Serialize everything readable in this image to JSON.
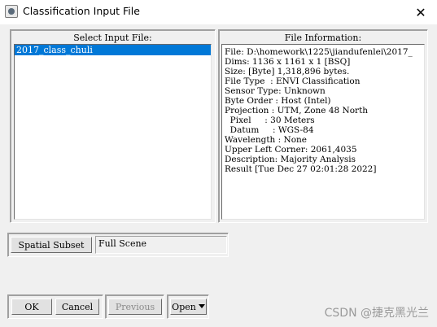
{
  "window": {
    "title": "Classification Input File",
    "close_glyph": "✕"
  },
  "select_panel": {
    "header": "Select Input File:",
    "files": [
      "2017_class_chuli"
    ]
  },
  "info_panel": {
    "header": "File Information:",
    "lines": [
      "File: D:\\homework\\1225\\jiandufenlei\\2017_",
      "Dims: 1136 x 1161 x 1 [BSQ]",
      "Size: [Byte] 1,318,896 bytes.",
      "File Type  : ENVI Classification",
      "Sensor Type: Unknown",
      "Byte Order : Host (Intel)",
      "Projection : UTM, Zone 48 North",
      "  Pixel     : 30 Meters",
      "  Datum     : WGS-84",
      "Wavelength : None",
      "Upper Left Corner: 2061,4035",
      "Description: Majority Analysis",
      "Result [Tue Dec 27 02:01:28 2022]"
    ]
  },
  "subset": {
    "button_label": "Spatial Subset",
    "value": "Full Scene"
  },
  "buttons": {
    "ok": "OK",
    "cancel": "Cancel",
    "previous": "Previous",
    "open": "Open"
  },
  "icons": {
    "app": "envi-app-icon",
    "close": "close-icon",
    "dropdown": "caret-down-icon"
  },
  "watermark": "CSDN @捷克黑光兰"
}
